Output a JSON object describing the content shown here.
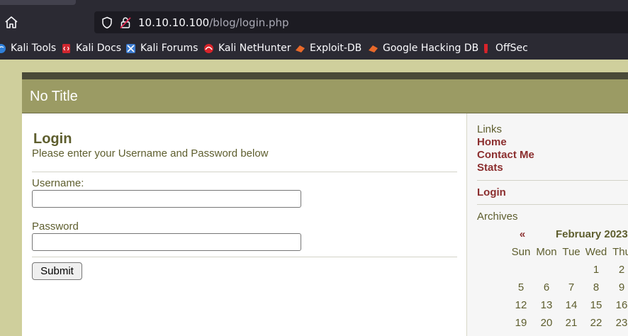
{
  "browser": {
    "url_host": "10.10.10.100",
    "url_path": "/blog/login.php",
    "bookmarks": [
      {
        "label": "Kali Tools",
        "icon": "kali-icon"
      },
      {
        "label": "Kali Docs",
        "icon": "kali-docs-icon"
      },
      {
        "label": "Kali Forums",
        "icon": "kali-forums-icon"
      },
      {
        "label": "Kali NetHunter",
        "icon": "nethunter-icon"
      },
      {
        "label": "Exploit-DB",
        "icon": "exploit-db-icon"
      },
      {
        "label": "Google Hacking DB",
        "icon": "ghdb-icon"
      },
      {
        "label": "OffSec",
        "icon": "offsec-icon"
      }
    ]
  },
  "page": {
    "title": "No Title"
  },
  "login": {
    "heading": "Login",
    "subtitle": "Please enter your Username and Password below",
    "username_label": "Username:",
    "username_value": "",
    "password_label": "Password",
    "password_value": "",
    "submit_label": "Submit"
  },
  "sidebar": {
    "links_heading": "Links",
    "links": [
      "Home",
      "Contact Me",
      "Stats"
    ],
    "login_link": "Login",
    "archives_heading": "Archives",
    "calendar": {
      "prev": "«",
      "month": "February 2023",
      "weekdays": [
        "Sun",
        "Mon",
        "Tue",
        "Wed",
        "Thu"
      ],
      "rows": [
        [
          "",
          "",
          "",
          "1",
          "2"
        ],
        [
          "5",
          "6",
          "7",
          "8",
          "9"
        ],
        [
          "12",
          "13",
          "14",
          "15",
          "16"
        ],
        [
          "19",
          "20",
          "21",
          "22",
          "23"
        ]
      ]
    }
  },
  "colors": {
    "header_bg": "#9b9b64",
    "text_olive": "#5e5e2e",
    "link_red": "#8b2e2e",
    "page_bg": "#cfcf9c"
  }
}
